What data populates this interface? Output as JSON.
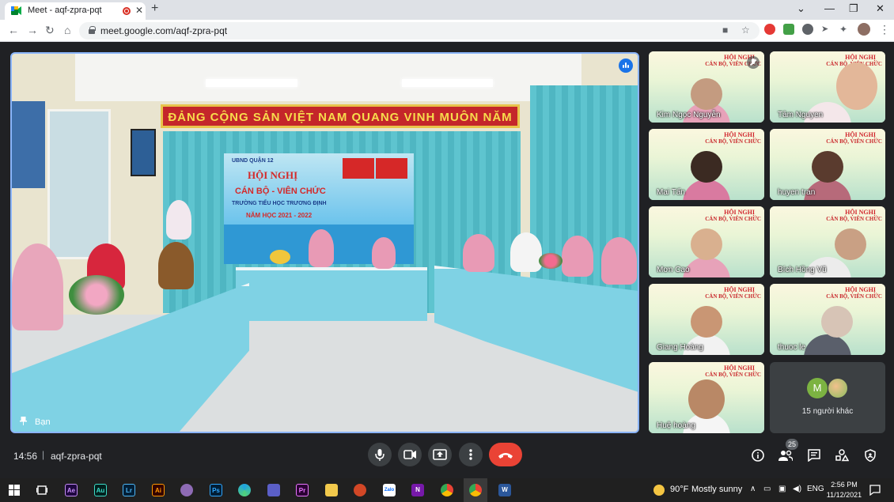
{
  "browser": {
    "tab_title": "Meet - aqf-zpra-pqt",
    "tab_close": "✕",
    "new_tab": "+",
    "url": "meet.google.com/aqf-zpra-pqt",
    "window_controls": [
      "⌄",
      "—",
      "❐",
      "✕"
    ]
  },
  "meeting": {
    "time": "14:56",
    "code": "aqf-zpra-pqt",
    "separator": "|",
    "people_count": "25",
    "main_tile": {
      "name": "Bạn",
      "banner_text": "ĐẢNG CỘNG SẢN VIỆT NAM QUANG VINH MUÔN NĂM",
      "backdrop_org": "UBND QUẬN 12",
      "backdrop_title1": "HỘI NGHỊ",
      "backdrop_title2": "CÁN BỘ - VIÊN CHỨC",
      "backdrop_school": "TRƯỜNG TIỂU HỌC TRƯƠNG ĐỊNH",
      "backdrop_year": "NĂM HỌC 2021 - 2022"
    },
    "thumb_title1": "HỘI NGHỊ",
    "thumb_title2": "CÁN BỘ, VIÊN CHỨC",
    "participants": [
      {
        "name": "Kim Ngọc Nguyễn",
        "muted": true
      },
      {
        "name": "Tâm Nguyen",
        "muted": false
      },
      {
        "name": "Mai Tấn",
        "muted": false
      },
      {
        "name": "huyen tran",
        "muted": false
      },
      {
        "name": "Mơn Cao",
        "muted": false
      },
      {
        "name": "Bích Hồng Vũ",
        "muted": false
      },
      {
        "name": "Giang Hoàng",
        "muted": false
      },
      {
        "name": "thuoc le",
        "muted": false
      },
      {
        "name": "Huệ hoàng",
        "muted": false
      }
    ],
    "others": {
      "avatar_letter": "M",
      "label": "15 người khác"
    }
  },
  "taskbar": {
    "apps": [
      "Ae",
      "Au",
      "Lr",
      "Ai",
      "Ps",
      "Pr",
      "N",
      "W"
    ],
    "weather_temp": "90°F",
    "weather_desc": "Mostly sunny",
    "language": "ENG",
    "time": "2:56 PM",
    "date": "11/12/2021"
  },
  "colors": {
    "meet_bg": "#202124",
    "end_call": "#ea4335",
    "active_border": "#8ab4f8"
  }
}
